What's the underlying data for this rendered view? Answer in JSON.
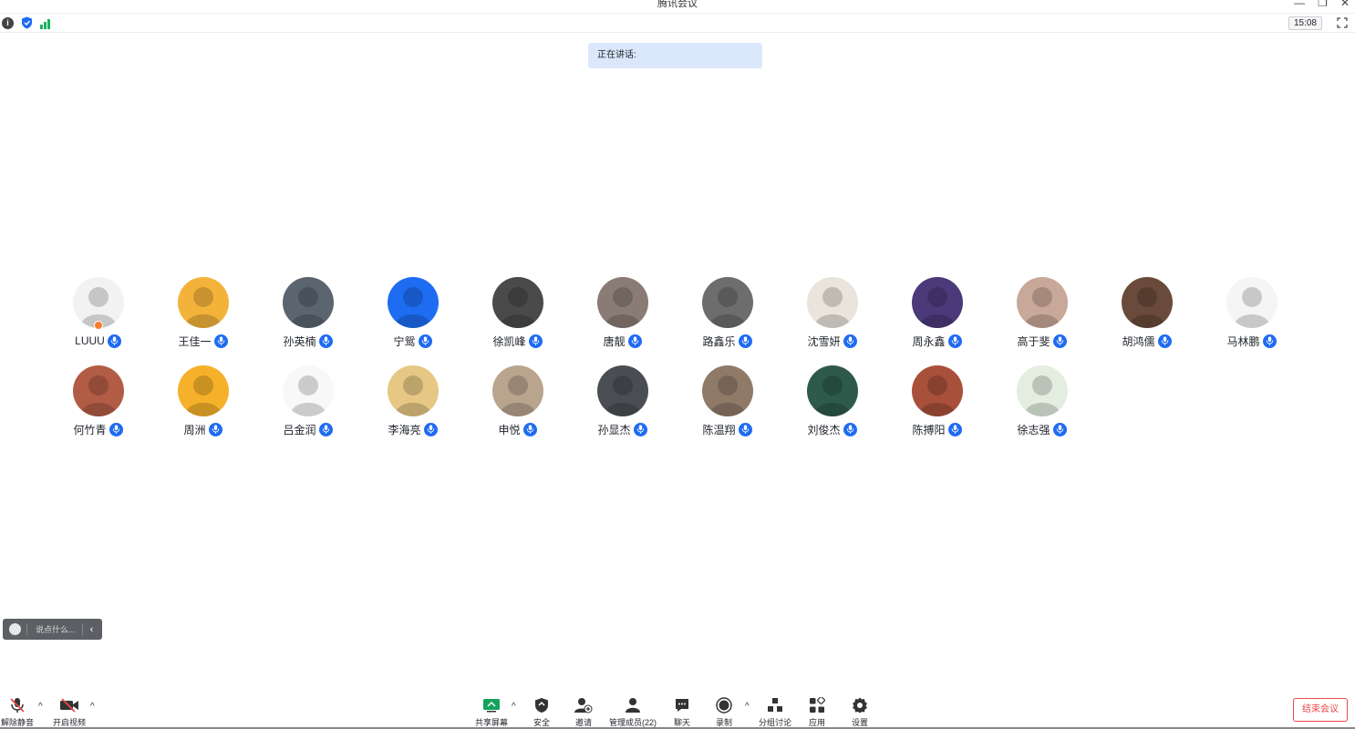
{
  "window": {
    "title": "腾讯会议",
    "minimize": "—",
    "restore": "❐",
    "close": "✕"
  },
  "infobar": {
    "clock": "15:08"
  },
  "speaking": {
    "label": "正在讲话:"
  },
  "participants_row1": [
    {
      "name": "LUUU",
      "color": "#f2f2f2",
      "icon": "cat-avatar"
    },
    {
      "name": "王佳一",
      "color": "#f3b33a",
      "icon": "cartoon-avatar"
    },
    {
      "name": "孙英楠",
      "color": "#5a6570",
      "icon": "character-avatar"
    },
    {
      "name": "宁鸳",
      "color": "#1e6cf2",
      "icon": "meeting-logo-avatar"
    },
    {
      "name": "徐凯峰",
      "color": "#4a4a4a",
      "icon": "photo-avatar"
    },
    {
      "name": "唐靓",
      "color": "#8a7c74",
      "icon": "photo-avatar"
    },
    {
      "name": "路鑫乐",
      "color": "#6d6d6d",
      "icon": "photo-avatar"
    },
    {
      "name": "沈雪妍",
      "color": "#e9e4dc",
      "icon": "anime-avatar"
    },
    {
      "name": "周永鑫",
      "color": "#4b3a7a",
      "icon": "game-avatar"
    },
    {
      "name": "高于斐",
      "color": "#c8a898",
      "icon": "photo-avatar"
    },
    {
      "name": "胡鸿儒",
      "color": "#6a4a3a",
      "icon": "sunset-avatar"
    },
    {
      "name": "马林鹏",
      "color": "#f5f5f5",
      "icon": "cat-sketch-avatar"
    }
  ],
  "participants_row2": [
    {
      "name": "何竹青",
      "color": "#b25c45",
      "icon": "anime-avatar"
    },
    {
      "name": "周洲",
      "color": "#f6b12a",
      "icon": "cartoon-avatar"
    },
    {
      "name": "吕金润",
      "color": "#f8f8f8",
      "icon": "sketch-avatar"
    },
    {
      "name": "李海亮",
      "color": "#e6c784",
      "icon": "bear-avatar"
    },
    {
      "name": "申悦",
      "color": "#b9a48e",
      "icon": "photo-avatar"
    },
    {
      "name": "孙显杰",
      "color": "#4a4d52",
      "icon": "photo-avatar"
    },
    {
      "name": "陈温翔",
      "color": "#8f7a68",
      "icon": "photo-avatar"
    },
    {
      "name": "刘俊杰",
      "color": "#2e5a4a",
      "icon": "photo-avatar"
    },
    {
      "name": "陈搏阳",
      "color": "#a8503a",
      "icon": "cartoon-avatar"
    },
    {
      "name": "徐志强",
      "color": "#e3eee0",
      "icon": "cartoon-avatar"
    }
  ],
  "chat": {
    "placeholder": "说点什么..."
  },
  "toolbar": {
    "unmute": "解除静音",
    "start_video": "开启视频",
    "share_screen": "共享屏幕",
    "security": "安全",
    "invite": "邀请",
    "manage_members": "管理成员(22)",
    "chat": "聊天",
    "record": "录制",
    "breakout": "分组讨论",
    "apps": "应用",
    "settings": "设置",
    "end_meeting": "结束会议"
  },
  "colors": {
    "accent": "#1f6bf2",
    "end": "#e84a4a",
    "speaking_bg": "#dbe8fc"
  }
}
